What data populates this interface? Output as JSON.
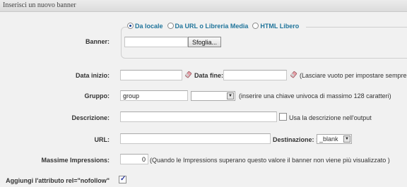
{
  "header": {
    "title": "Inserisci un nuovo banner"
  },
  "banner": {
    "label": "Banner:",
    "source_options": [
      "Da locale",
      "Da URL o Libreria Media",
      "HTML Libero"
    ],
    "selected_source": "Da locale",
    "file_value": "",
    "browse_label": "Sfoglia..."
  },
  "dates": {
    "start_label": "Data inizio:",
    "start_value": "",
    "end_label": "Data fine:",
    "end_value": "",
    "hint": "(Lasciare vuoto per impostare sempre"
  },
  "group": {
    "label": "Gruppo:",
    "value": "group",
    "select_value": "",
    "hint": "(inserire una chiave univoca di massimo 128 caratteri)"
  },
  "description": {
    "label": "Descrizione:",
    "value": "",
    "checkbox_label": "Usa la descrizione nell'output",
    "checkbox_checked": false
  },
  "url": {
    "label": "URL:",
    "value": "",
    "target_label": "Destinazione: :",
    "target_value": "_blank"
  },
  "impressions": {
    "label": "Massime Impressions:",
    "value": "0",
    "hint": "(Quando le Impressions superano questo valore il banner non viene più visualizzato )"
  },
  "nofollow": {
    "label": "Aggiungi l'attributo rel=\"nofollow\"",
    "checked": true
  },
  "colors": {
    "link": "#21759b",
    "background": "#f1f1f1"
  },
  "icons": [
    "eraser-icon",
    "dropdown-arrow-icon",
    "checkmark-icon"
  ]
}
